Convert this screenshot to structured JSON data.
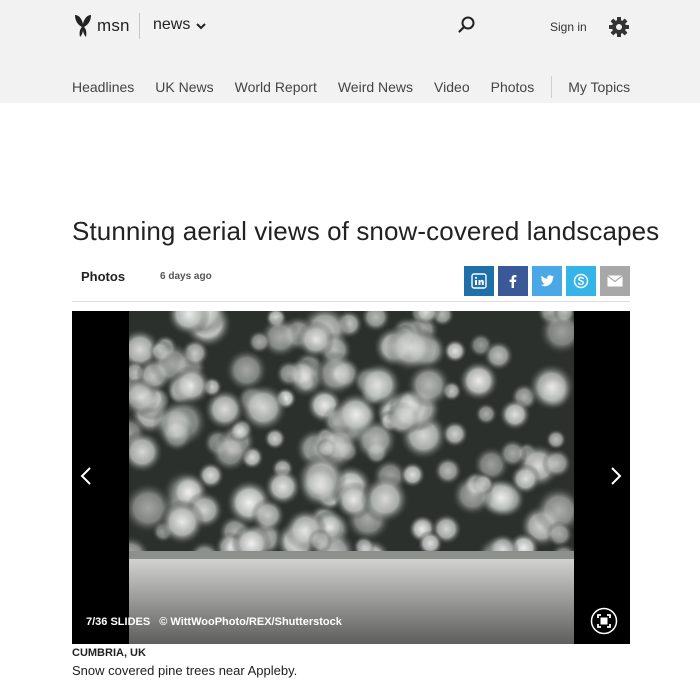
{
  "header": {
    "brand": "msn",
    "section": "news",
    "signin_label": "Sign in",
    "icons": {
      "logo": "msn-butterfly-icon",
      "chevron": "chevron-down-icon",
      "search": "search-icon",
      "settings": "gear-icon"
    }
  },
  "nav": {
    "items": [
      "Headlines",
      "UK News",
      "World Report",
      "Weird News",
      "Video",
      "Photos"
    ],
    "my_topics": "My Topics"
  },
  "article": {
    "title": "Stunning aerial views of snow-covered landscapes",
    "category": "Photos",
    "time_ago": "6 days ago",
    "share_icons": [
      "linkedin-icon",
      "facebook-icon",
      "twitter-icon",
      "skype-icon",
      "email-icon"
    ]
  },
  "slideshow": {
    "counter": "7/36 SLIDES",
    "credit": "© WittWooPhoto/REX/Shutterstock",
    "caption_location": "CUMBRIA, UK",
    "caption_text": "Snow covered pine trees near Appleby."
  },
  "colors": {
    "header_bg": "#f2f2f2",
    "linkedin": "#1f6fa8",
    "facebook": "#3b5998",
    "twitter": "#4aa8e6",
    "skype": "#35b4e8",
    "email": "#a8a8a8"
  }
}
